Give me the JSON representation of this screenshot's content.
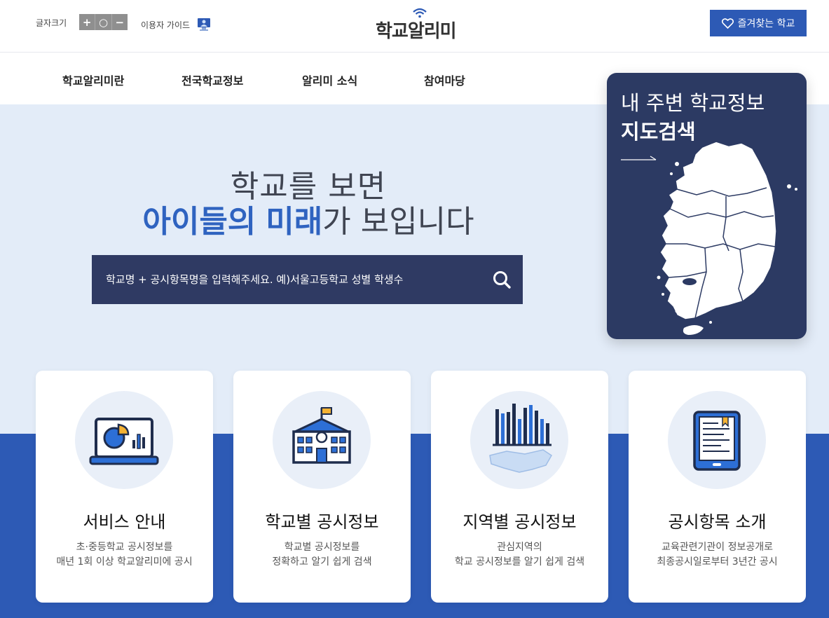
{
  "topbar": {
    "font_size_label": "글자크기",
    "font_size_buttons": [
      "+",
      "○",
      "−"
    ],
    "guide_label": "이용자 가이드",
    "logo_text": "학교알리미",
    "favorite_button": "즐겨찾는 학교"
  },
  "nav": {
    "items": [
      {
        "label": "학교알리미란"
      },
      {
        "label": "전국학교정보"
      },
      {
        "label": "알리미 소식"
      },
      {
        "label": "참여마당"
      }
    ]
  },
  "hero": {
    "line1": "학교를 보면",
    "line2_highlight_a": "아이들의",
    "line2_highlight_b": "미래",
    "line2_rest": "가 보입니다",
    "search_placeholder": "학교명 + 공시항목명을 입력해주세요. 예)서울고등학교 성별 학생수"
  },
  "map_card": {
    "title_line1": "내 주변 학교정보",
    "title_line2": "지도검색"
  },
  "cards": [
    {
      "title": "서비스 안내",
      "desc_line1": "초·중등학교 공시정보를",
      "desc_line2": "매년 1회 이상 학교알리미에 공시",
      "icon": "laptop-chart-icon"
    },
    {
      "title": "학교별 공시정보",
      "desc_line1": "학교별 공시정보를",
      "desc_line2": "정확하고 알기 쉽게 검색",
      "icon": "school-building-icon"
    },
    {
      "title": "지역별 공시정보",
      "desc_line1": "관심지역의",
      "desc_line2": "학교 공시정보를 알기 쉽게 검색",
      "icon": "region-bar-chart-icon"
    },
    {
      "title": "공시항목 소개",
      "desc_line1": "교육관련기관이 정보공개로",
      "desc_line2": "최종공시일로부터 3년간 공시",
      "icon": "tablet-document-icon"
    }
  ],
  "colors": {
    "primary": "#2d5ab5",
    "navy": "#2f3a63",
    "hero_bg": "#e3ecf8",
    "highlight": "#2f63c0"
  }
}
